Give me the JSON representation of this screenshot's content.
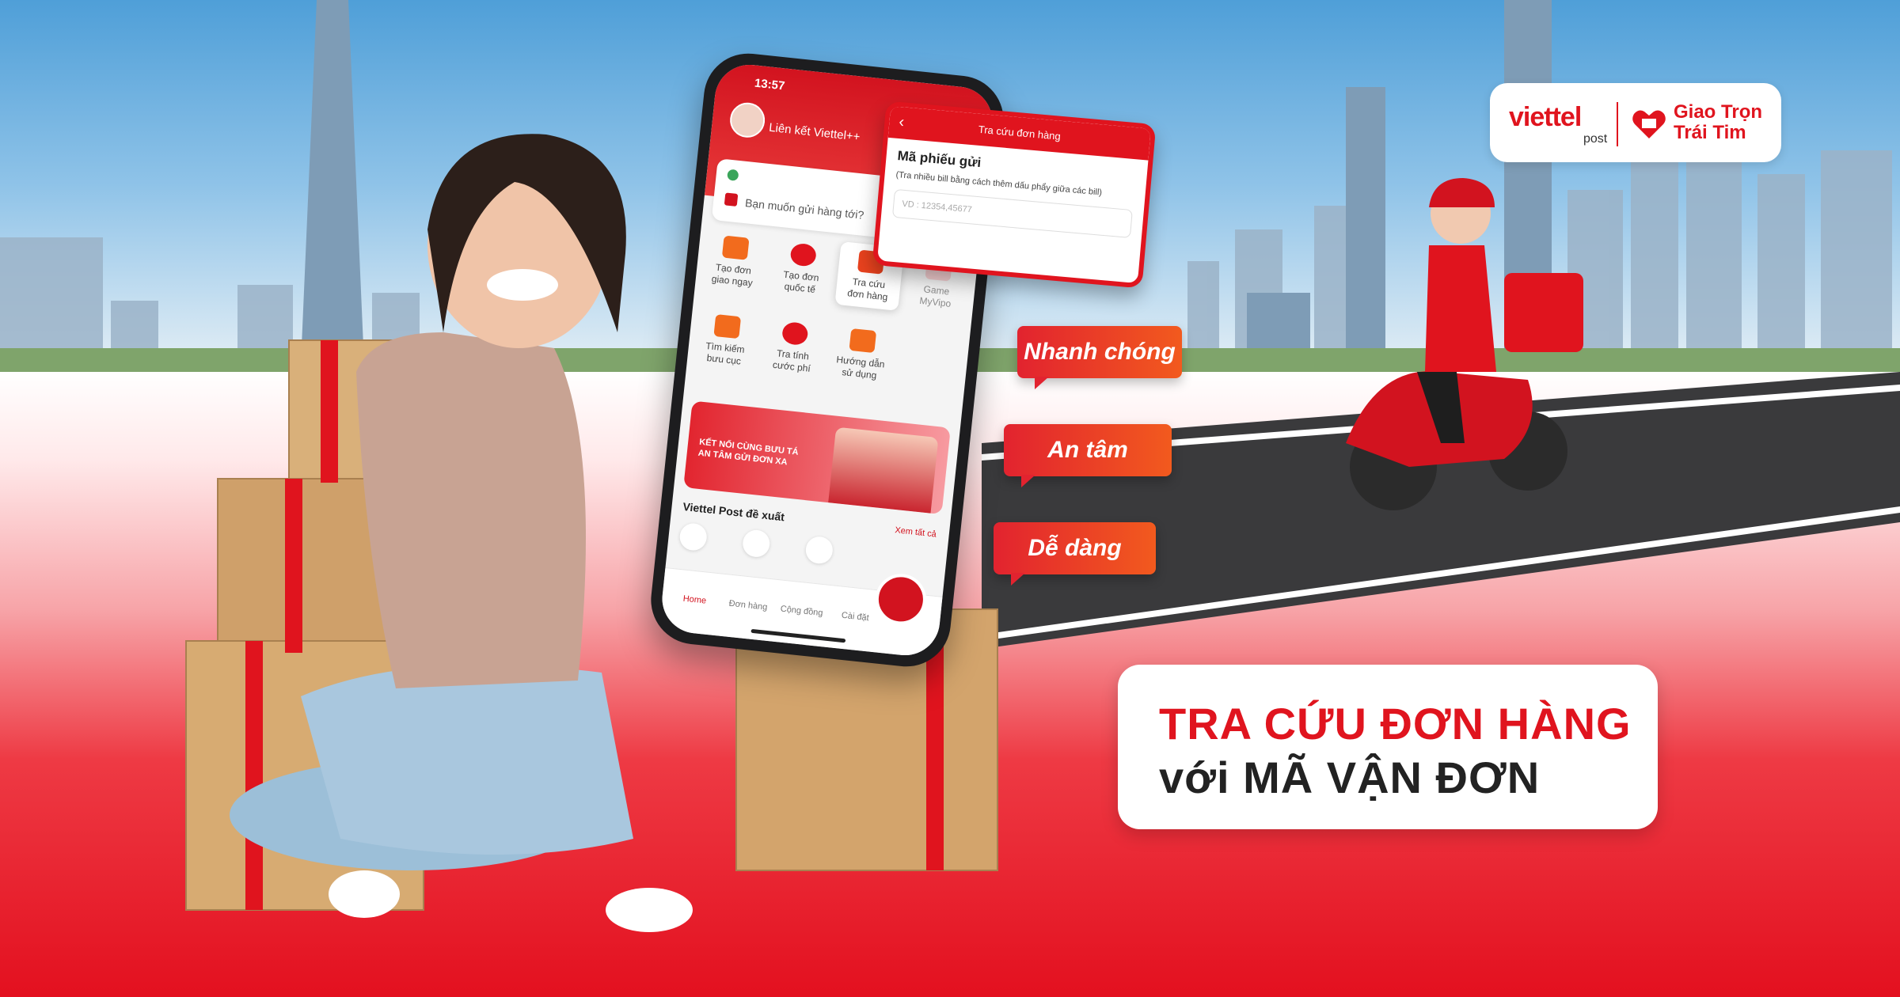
{
  "brand": {
    "name": "viettel",
    "sub": "post",
    "slogan_line1": "Giao Trọn",
    "slogan_line2": "Trái Tim",
    "colors": {
      "primary": "#e0141e",
      "accent": "#f25a1e"
    }
  },
  "headline": {
    "line1": "TRA CỨU ĐƠN HÀNG",
    "line2": "với MÃ VẬN ĐƠN"
  },
  "badges": [
    "Nhanh chóng",
    "An tâm",
    "Dễ dàng"
  ],
  "phone": {
    "time": "13:57",
    "link_label": "Liên kết Viettel++",
    "send_placeholder": "Bạn muốn gửi hàng tới?",
    "grid": [
      {
        "label1": "Tạo đơn",
        "label2": "giao ngay"
      },
      {
        "label1": "Tạo đơn",
        "label2": "quốc tế"
      },
      {
        "label1": "Tra cứu",
        "label2": "đơn hàng"
      },
      {
        "label1": "Game",
        "label2": "MyVipo"
      },
      {
        "label1": "Tìm kiếm",
        "label2": "bưu cục"
      },
      {
        "label1": "Tra tính",
        "label2": "cước phí"
      },
      {
        "label1": "Hướng dẫn",
        "label2": "sử dụng"
      }
    ],
    "banner_text": "KẾT NỐI CÙNG BƯU TÁ AN TÂM GỬI ĐƠN XA",
    "suggest_title": "Viettel Post đề xuất",
    "see_all": "Xem tất cả",
    "tabs": [
      "Home",
      "Đơn hàng",
      "Cộng đồng",
      "Cài đặt"
    ]
  },
  "popup": {
    "header": "Tra cứu đơn hàng",
    "field_label": "Mã phiếu gửi",
    "hint": "(Tra nhiều bill bằng cách thêm dấu phẩy giữa các bill)",
    "placeholder": "VD : 12354,45677"
  }
}
